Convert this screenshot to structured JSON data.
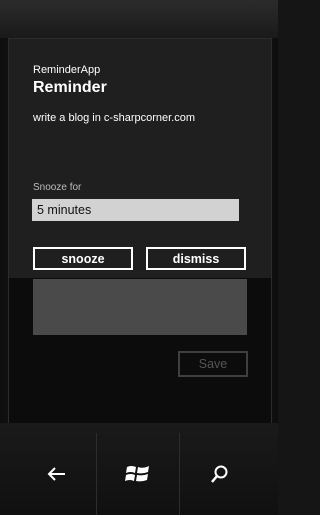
{
  "popup": {
    "app_name": "ReminderApp",
    "title": "Reminder",
    "message": "write a blog in c-sharpcorner.com",
    "snooze_label": "Snooze for",
    "snooze_value": "5 minutes",
    "snooze_button": "snooze",
    "dismiss_button": "dismiss"
  },
  "background": {
    "save_button": "Save"
  },
  "navigation": {
    "back_icon": "back-arrow-icon",
    "start_icon": "windows-logo-icon",
    "search_icon": "search-icon"
  },
  "colors": {
    "popup_bg": "#1f1f1f",
    "button_border": "#ffffff",
    "textbox_bg": "#4a4a4a"
  }
}
